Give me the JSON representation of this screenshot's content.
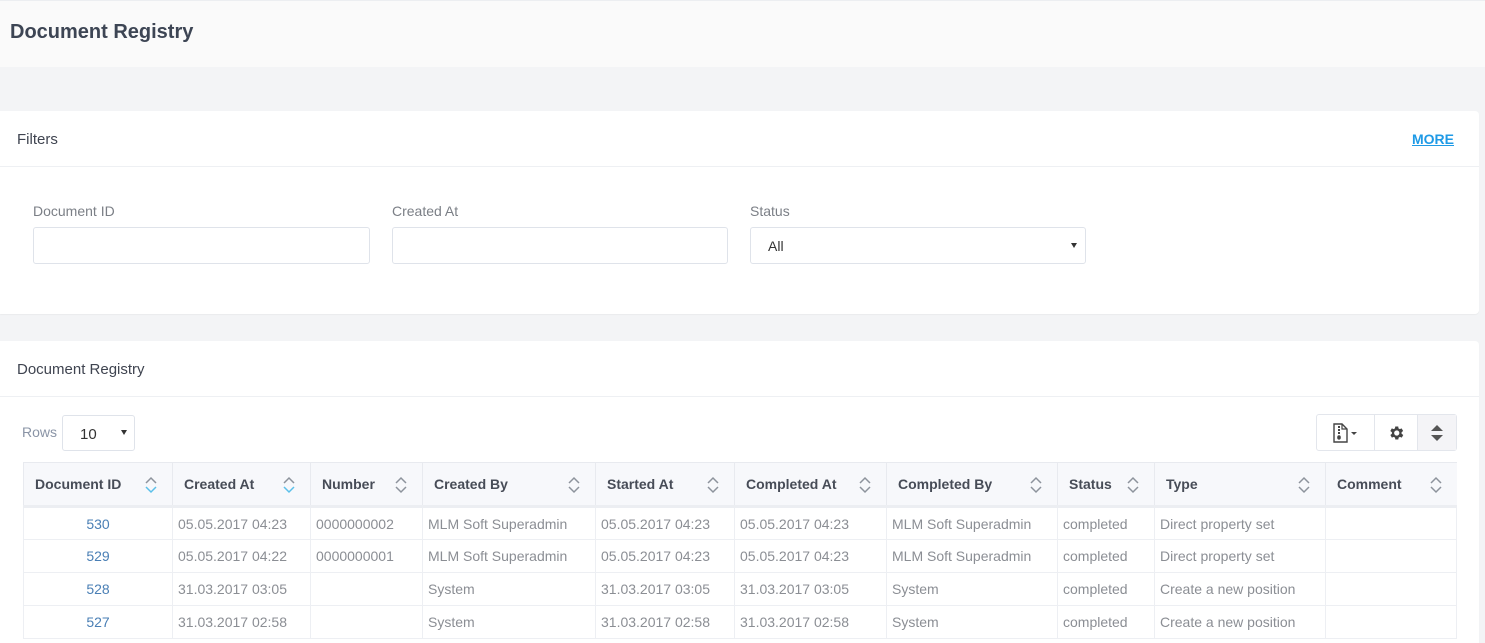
{
  "header": {
    "title": "Document Registry"
  },
  "filters": {
    "title": "Filters",
    "more_label": "MORE",
    "fields": [
      {
        "label": "Document ID",
        "value": "",
        "placeholder": ""
      },
      {
        "label": "Created At",
        "value": "",
        "placeholder": ""
      },
      {
        "label": "Status",
        "value": "All"
      }
    ]
  },
  "registry": {
    "title": "Document Registry",
    "rows_label": "Rows",
    "rows_value": "10",
    "toolbar": {
      "export_icon": "file-zip-icon",
      "settings_icon": "gear-icon",
      "sort_icon": "sort-icon"
    },
    "columns": [
      "Document ID",
      "Created At",
      "Number",
      "Created By",
      "Started At",
      "Completed At",
      "Completed By",
      "Status",
      "Type",
      "Comment"
    ],
    "sorted_column": "Document ID",
    "rows": [
      [
        "530",
        "05.05.2017 04:23",
        "0000000002",
        "MLM Soft Superadmin",
        "05.05.2017 04:23",
        "05.05.2017 04:23",
        "MLM Soft Superadmin",
        "completed",
        "Direct property set",
        ""
      ],
      [
        "529",
        "05.05.2017 04:22",
        "0000000001",
        "MLM Soft Superadmin",
        "05.05.2017 04:23",
        "05.05.2017 04:23",
        "MLM Soft Superadmin",
        "completed",
        "Direct property set",
        ""
      ],
      [
        "528",
        "31.03.2017 03:05",
        "",
        "System",
        "31.03.2017 03:05",
        "31.03.2017 03:05",
        "System",
        "completed",
        "Create a new position",
        ""
      ],
      [
        "527",
        "31.03.2017 02:58",
        "",
        "System",
        "31.03.2017 02:58",
        "31.03.2017 02:58",
        "System",
        "completed",
        "Create a new position",
        ""
      ]
    ]
  },
  "colors": {
    "link": "#1e9ae6",
    "id_link": "#4a7fb5",
    "sort_active": "#5bc0ea"
  }
}
